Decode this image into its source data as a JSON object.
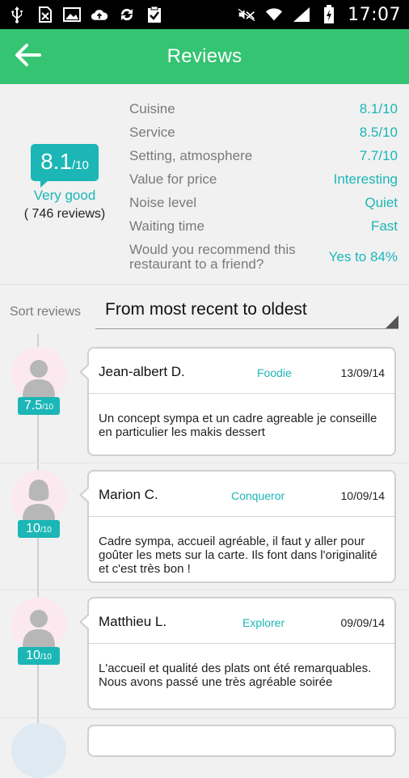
{
  "status_bar": {
    "time": "17:07",
    "left_icons": [
      "usb-icon",
      "sd-card-icon",
      "image-icon",
      "cloud-upload-icon",
      "sync-icon",
      "task-check-icon"
    ],
    "right_icons": [
      "mute-icon",
      "wifi-icon",
      "signal-icon",
      "battery-icon"
    ]
  },
  "app_bar": {
    "title": "Reviews",
    "back_icon": "arrow-left-icon",
    "color": "#34c472"
  },
  "summary": {
    "overall": {
      "score": "8.1",
      "denominator": "/10",
      "label": "Very good",
      "count": "( 746 reviews)"
    },
    "criteria": [
      {
        "label": "Cuisine",
        "value": "8.1/10"
      },
      {
        "label": "Service",
        "value": "8.5/10"
      },
      {
        "label": "Setting, atmosphere",
        "value": "7.7/10"
      },
      {
        "label": "Value for price",
        "value": "Interesting"
      },
      {
        "label": "Noise level",
        "value": "Quiet"
      },
      {
        "label": "Waiting time",
        "value": "Fast"
      },
      {
        "label": "Would you recommend this restaurant to a friend?",
        "value": "Yes to 84%"
      }
    ]
  },
  "sort": {
    "label": "Sort reviews",
    "value": "From most recent to oldest"
  },
  "reviews": [
    {
      "author": "Jean-albert D.",
      "level": "Foodie",
      "date": "13/09/14",
      "score": "7.5",
      "score_denom": "/10",
      "avatar": "male-avatar-icon",
      "text": "Un concept sympa et un cadre agreable je conseille en particulier les makis dessert"
    },
    {
      "author": "Marion C.",
      "level": "Conqueror",
      "date": "10/09/14",
      "score": "10",
      "score_denom": "/10",
      "avatar": "female-avatar-icon",
      "text": "Cadre sympa, accueil agréable, il faut y aller pour goûter les mets sur la carte. Ils font dans l'originalité et c'est très bon !"
    },
    {
      "author": "Matthieu L.",
      "level": "Explorer",
      "date": "09/09/14",
      "score": "10",
      "score_denom": "/10",
      "avatar": "male-avatar-icon",
      "text": "L'accueil et qualité des plats ont été remarquables. Nous avons passé une très agréable soirée"
    }
  ],
  "colors": {
    "accent": "#1cb6b6",
    "header": "#34c472"
  }
}
